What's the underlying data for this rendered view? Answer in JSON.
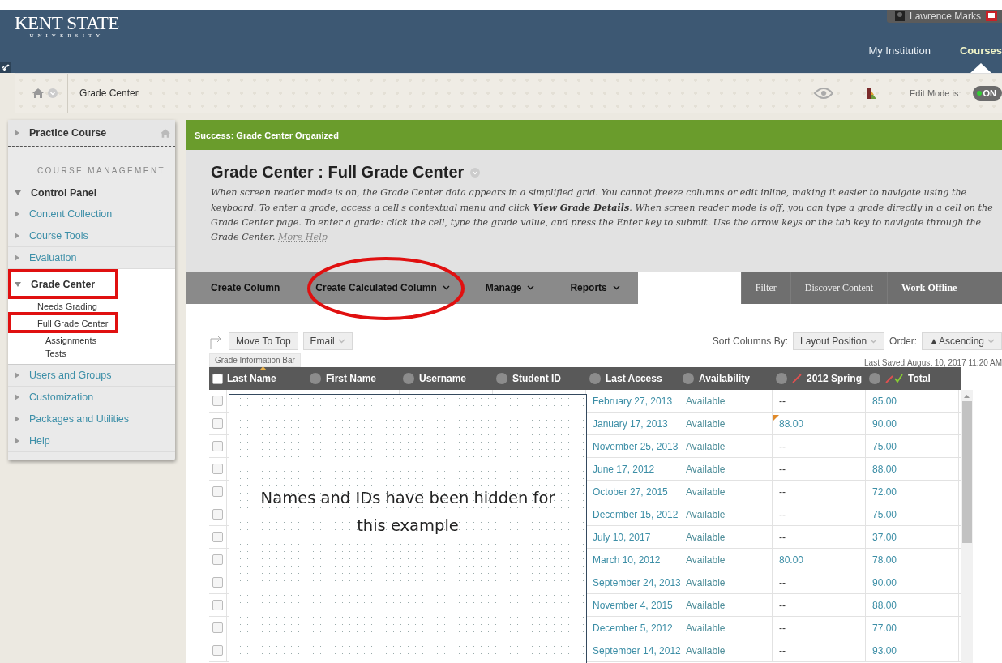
{
  "header": {
    "logo": {
      "name": "KENT STATE",
      "sub": "UNIVERSITY"
    },
    "user_name": "Lawrence Marks",
    "tabs": [
      {
        "label": "My Institution",
        "selected": false
      },
      {
        "label": "Courses",
        "selected": true
      }
    ]
  },
  "breadcrumb": {
    "label": "Grade Center"
  },
  "edit_mode": {
    "label": "Edit Mode is:",
    "text": "ON",
    "on": true
  },
  "sidebar": {
    "course": "Practice Course",
    "section": "COURSE MANAGEMENT",
    "menu": [
      {
        "label": "Control Panel",
        "expanded": true,
        "children": [
          {
            "label": "Content Collection",
            "expanded": false,
            "annotated": false
          },
          {
            "label": "Course Tools",
            "expanded": false,
            "annotated": false
          },
          {
            "label": "Evaluation",
            "expanded": false,
            "annotated": false
          },
          {
            "label": "Grade Center",
            "expanded": true,
            "annotated": true,
            "children": [
              {
                "label": "Needs Grading",
                "annotated": false
              },
              {
                "label": "Full Grade Center",
                "annotated": true,
                "children": [
                  {
                    "label": "Assignments"
                  },
                  {
                    "label": "Tests"
                  }
                ]
              }
            ]
          }
        ]
      },
      {
        "label": "Users and Groups",
        "expanded": false
      },
      {
        "label": "Customization",
        "expanded": false
      },
      {
        "label": "Packages and Utilities",
        "expanded": false
      },
      {
        "label": "Help",
        "expanded": false
      }
    ]
  },
  "success_message": "Success: Grade Center Organized",
  "page_title": "Grade Center : Full Grade Center",
  "description": "When screen reader mode is on, the Grade Center data appears in a simplified grid. You cannot freeze columns or edit inline, making it easier to navigate using the keyboard. To enter a grade, access a cell's contextual menu and click **View Grade Details**. When screen reader mode is off, you can type a grade directly in a cell on the Grade Center page. To enter a grade: click the cell, type the grade value, and press the Enter key to submit. Use the arrow keys or the tab key to navigate through the Grade Center.",
  "more_help": "More Help",
  "action_bar": {
    "left": [
      {
        "label": "Create Column",
        "dropdown": false
      },
      {
        "label": "Create Calculated Column",
        "dropdown": true
      },
      {
        "label": "Manage",
        "dropdown": true
      },
      {
        "label": "Reports",
        "dropdown": true
      }
    ],
    "right": [
      "Filter",
      "Discover Content",
      "Work Offline"
    ]
  },
  "toolbar": {
    "buttons": [
      {
        "label": "Move To Top",
        "dropdown": false
      },
      {
        "label": "Email",
        "dropdown": true
      }
    ],
    "sort_label": "Sort Columns By:",
    "sort_value": "Layout Position",
    "order_label": "Order:",
    "order_value": "▲Ascending"
  },
  "info_bar": "Grade Information Bar",
  "last_saved": "Last Saved:August 10, 2017 11:20 AM",
  "table": {
    "select_all_checked": false,
    "columns": [
      {
        "label": "Last Name",
        "kind": "plain",
        "sorted": true
      },
      {
        "label": "First Name",
        "kind": "plain",
        "sorted": false
      },
      {
        "label": "Username",
        "kind": "plain",
        "sorted": false
      },
      {
        "label": "Student ID",
        "kind": "plain",
        "sorted": false
      },
      {
        "label": "Last Access",
        "kind": "plain",
        "sorted": false
      },
      {
        "label": "Availability",
        "kind": "plain",
        "sorted": false
      },
      {
        "label": "2012 Spring",
        "kind": "graded",
        "sorted": false
      },
      {
        "label": "Total",
        "kind": "total",
        "sorted": false
      }
    ],
    "rows": [
      {
        "last_access": "February 27, 2013",
        "availability": "Available",
        "spring": "--",
        "total": "85.00",
        "flagged": false,
        "checked": false
      },
      {
        "last_access": "January 17, 2013",
        "availability": "Available",
        "spring": "88.00",
        "total": "90.00",
        "flagged": true,
        "checked": false
      },
      {
        "last_access": "November 25, 2013",
        "availability": "Available",
        "spring": "--",
        "total": "75.00",
        "flagged": false,
        "checked": false
      },
      {
        "last_access": "June 17, 2012",
        "availability": "Available",
        "spring": "--",
        "total": "88.00",
        "flagged": false,
        "checked": false
      },
      {
        "last_access": "October 27, 2015",
        "availability": "Available",
        "spring": "--",
        "total": "72.00",
        "flagged": false,
        "checked": false
      },
      {
        "last_access": "December 15, 2012",
        "availability": "Available",
        "spring": "--",
        "total": "75.00",
        "flagged": false,
        "checked": false
      },
      {
        "last_access": "July 10, 2017",
        "availability": "Available",
        "spring": "--",
        "total": "37.00",
        "flagged": false,
        "checked": false
      },
      {
        "last_access": "March 10, 2012",
        "availability": "Available",
        "spring": "80.00",
        "total": "78.00",
        "flagged": false,
        "checked": false
      },
      {
        "last_access": "September 24, 2013",
        "availability": "Available",
        "spring": "--",
        "total": "90.00",
        "flagged": false,
        "checked": false
      },
      {
        "last_access": "November 4, 2015",
        "availability": "Available",
        "spring": "--",
        "total": "88.00",
        "flagged": false,
        "checked": false
      },
      {
        "last_access": "December 5, 2012",
        "availability": "Available",
        "spring": "--",
        "total": "77.00",
        "flagged": false,
        "checked": false
      },
      {
        "last_access": "September 14, 2012",
        "availability": "Available",
        "spring": "--",
        "total": "93.00",
        "flagged": false,
        "checked": false
      }
    ]
  },
  "redaction_note": "Names and IDs have been hidden for this example"
}
